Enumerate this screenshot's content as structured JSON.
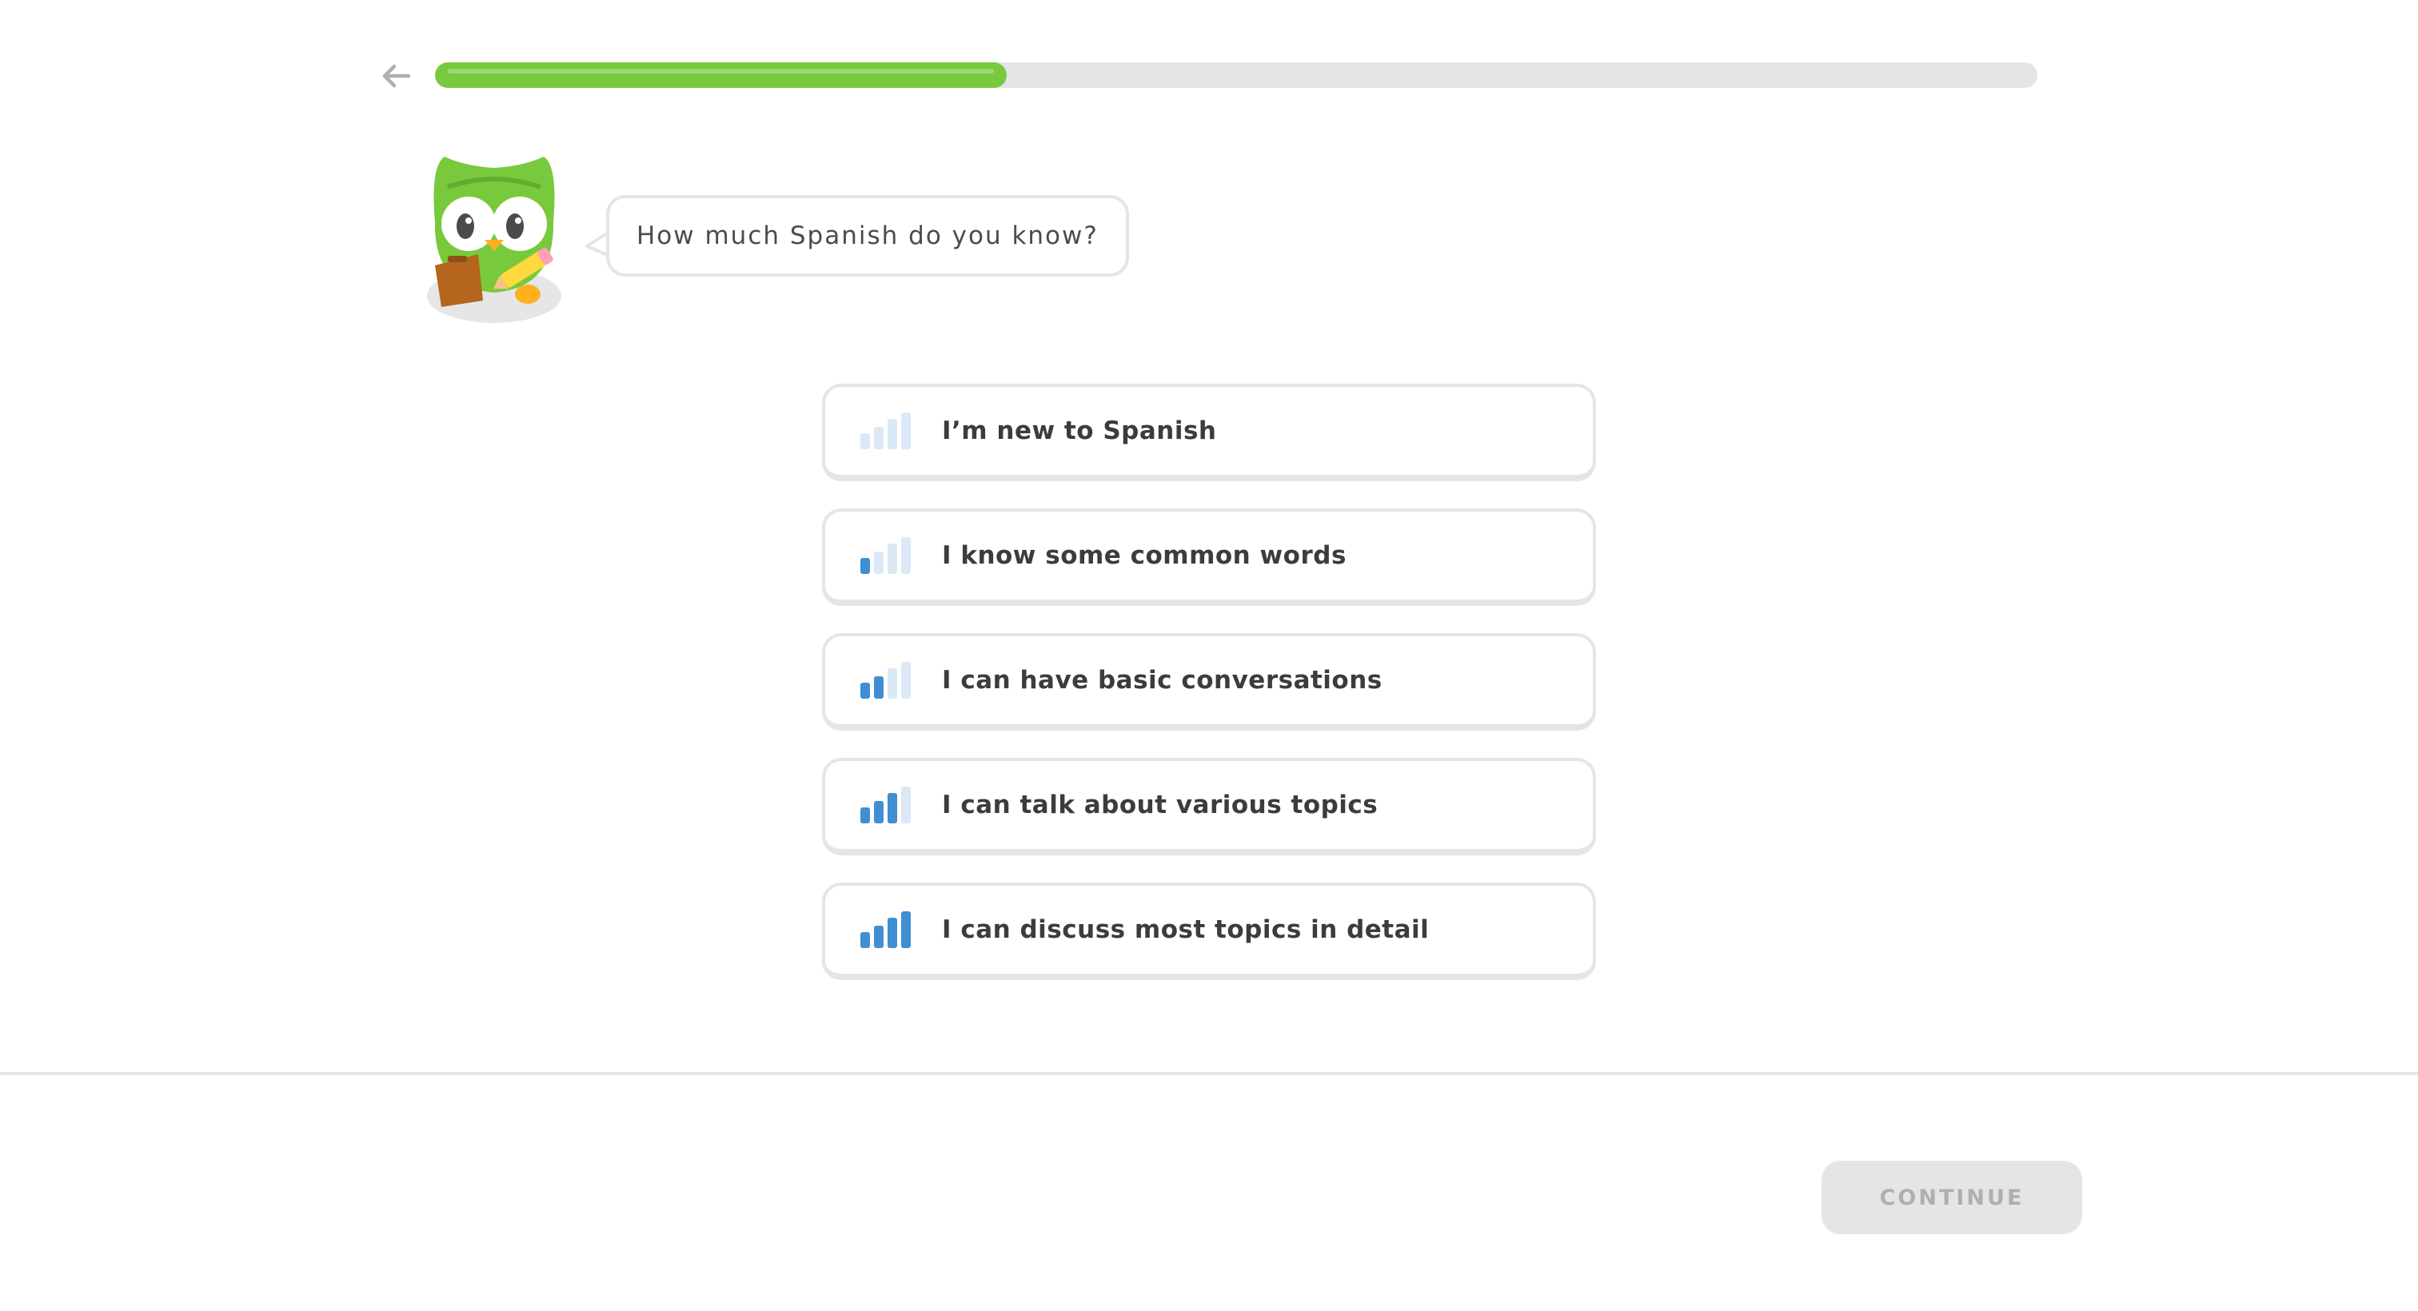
{
  "header": {
    "back_icon": "arrow-left-icon",
    "progress_fraction": 0.357
  },
  "mascot": {
    "icon": "owl-with-clipboard-icon"
  },
  "prompt": {
    "text": "How much Spanish do you know?"
  },
  "options": [
    {
      "label": "I’m new to Spanish",
      "level": 0
    },
    {
      "label": "I know some common words",
      "level": 1
    },
    {
      "label": "I can have basic conversations",
      "level": 2
    },
    {
      "label": "I can talk about various topics",
      "level": 3
    },
    {
      "label": "I can discuss most topics in detail",
      "level": 4
    }
  ],
  "footer": {
    "continue_label": "CONTINUE",
    "continue_enabled": false
  },
  "colors": {
    "progress_green": "#77c93e",
    "bar_active_blue": "#3f8fd2",
    "bar_inactive": "#dbe9f6",
    "border_gray": "#e5e5e5"
  }
}
